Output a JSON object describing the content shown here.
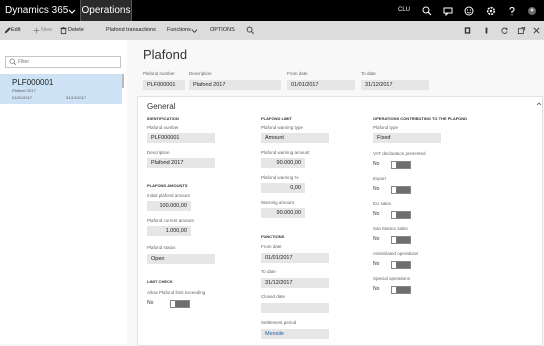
{
  "topbar": {
    "app_title": "Dynamics 365",
    "module": "Operations",
    "company": "CLU",
    "icons": [
      "search-icon",
      "chat-icon",
      "smiley-icon",
      "gear-icon",
      "help-icon",
      "user-icon"
    ]
  },
  "actionbar": {
    "edit": "Edit",
    "new": "New",
    "delete": "Delete",
    "transactions": "Plafond transactions",
    "functions": "Functions",
    "options": "OPTIONS"
  },
  "left": {
    "filter_placeholder": "Filter",
    "items": [
      {
        "id": "PLF000001",
        "description": "Plafond 2017",
        "from": "01/01/2017",
        "to": "31/12/2017"
      }
    ]
  },
  "header": {
    "title": "Plafond",
    "labels": {
      "number": "Plafond number",
      "description": "Description",
      "from": "From date",
      "to": "To date"
    },
    "values": {
      "number": "PLF000001",
      "description": "Plafond 2017",
      "from": "01/01/2017",
      "to": "31/12/2017"
    }
  },
  "general": {
    "title": "General",
    "identification": {
      "heading": "IDENTIFICATION",
      "number_label": "Plafond number",
      "number": "PLF000001",
      "description_label": "Description",
      "description": "Plafond 2017"
    },
    "amounts": {
      "heading": "PLAFOND AMOUNTS",
      "initial_label": "Initial plafond amount",
      "initial": "100.000,00",
      "current_label": "Plafond current amount",
      "current": "1.000,00",
      "status_label": "Plafond status",
      "status": "Open"
    },
    "limit_check": {
      "heading": "LIMIT CHECK",
      "allow_label": "Allow Plafond limit exceeding",
      "allow": "No"
    },
    "plafond_limit": {
      "heading": "PLAFOND LIMIT",
      "warning_type_label": "Plafond warning type",
      "warning_type": "Amount",
      "warning_amount_label": "Plafond warning amount",
      "warning_amount": "90.000,00",
      "warning_pct_label": "Plafond warning %",
      "warning_pct": "0,00",
      "warn_amount_label": "Warning amount",
      "warn_amount": "90.000,00"
    },
    "functions": {
      "heading": "FUNCTIONS",
      "from_label": "From date",
      "from": "01/01/2017",
      "to_label": "To date",
      "to": "31/12/2017",
      "closed_label": "Closed date",
      "closed": "",
      "settlement_label": "Settlement period",
      "settlement": "Mensile"
    },
    "operations": {
      "heading": "OPERATIONS CONTRIBUTING TO THE PLAFOND",
      "type_label": "Plafond type",
      "type": "Fixed",
      "toggles": [
        {
          "label": "VAT declaration presented",
          "value": "No"
        },
        {
          "label": "Export",
          "value": "No"
        },
        {
          "label": "EU sales",
          "value": "No"
        },
        {
          "label": "San Marino sales",
          "value": "No"
        },
        {
          "label": "Assimilated operations",
          "value": "No"
        },
        {
          "label": "Special operations",
          "value": "No"
        }
      ]
    }
  }
}
